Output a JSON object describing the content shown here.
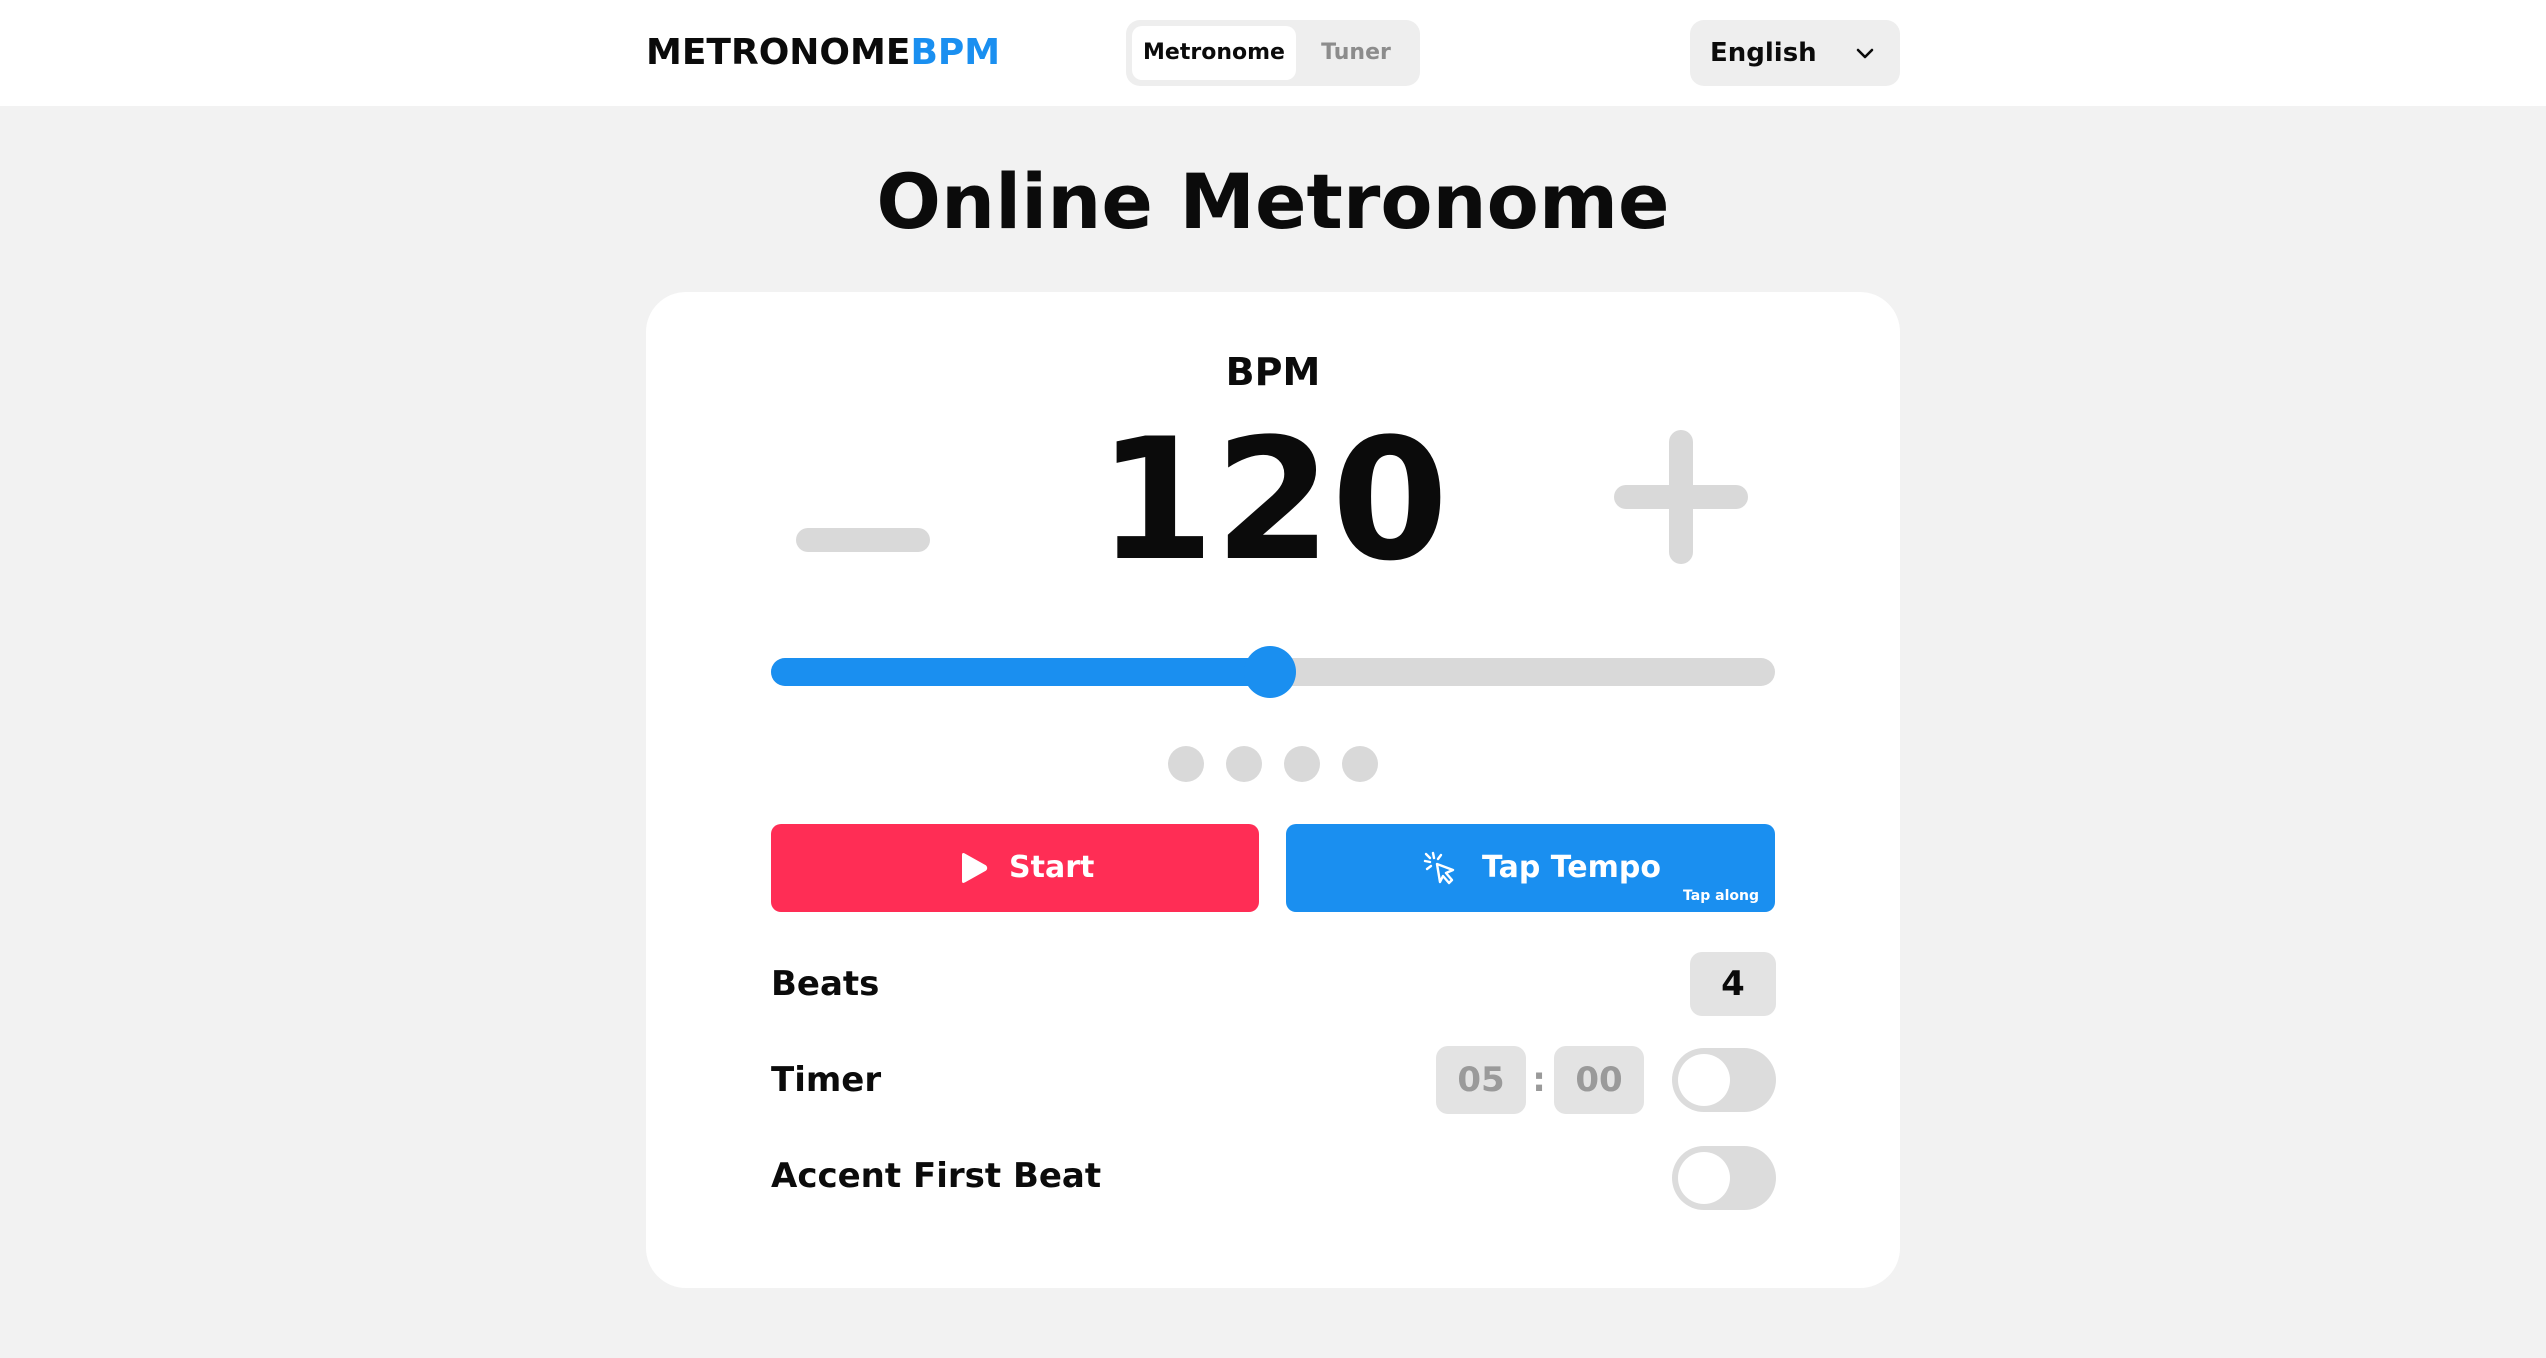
{
  "header": {
    "logo_main": "METRONOME",
    "logo_accent": "BPM",
    "tabs": [
      {
        "label": "Metronome",
        "active": true
      },
      {
        "label": "Tuner",
        "active": false
      }
    ],
    "language": "English"
  },
  "page_title": "Online Metronome",
  "metronome": {
    "bpm_label": "BPM",
    "bpm_value": "120",
    "slider_fraction": 0.497,
    "beat_dot_count": 4,
    "start_label": "Start",
    "tap_label": "Tap Tempo",
    "tap_sub": "Tap along"
  },
  "settings": {
    "beats_label": "Beats",
    "beats_value": "4",
    "timer_label": "Timer",
    "timer_minutes": "05",
    "timer_separator": ":",
    "timer_seconds": "00",
    "timer_enabled": false,
    "accent_label": "Accent First Beat",
    "accent_enabled": false
  },
  "colors": {
    "accent_blue": "#1a8ff0",
    "start_red": "#ff2d55",
    "control_gray": "#d9d9d9",
    "background": "#f2f2f2"
  },
  "icons": {
    "language": "chevron-down-icon",
    "start": "play-icon",
    "tap": "tap-pointer-icon",
    "decrease": "minus-icon",
    "increase": "plus-icon"
  }
}
